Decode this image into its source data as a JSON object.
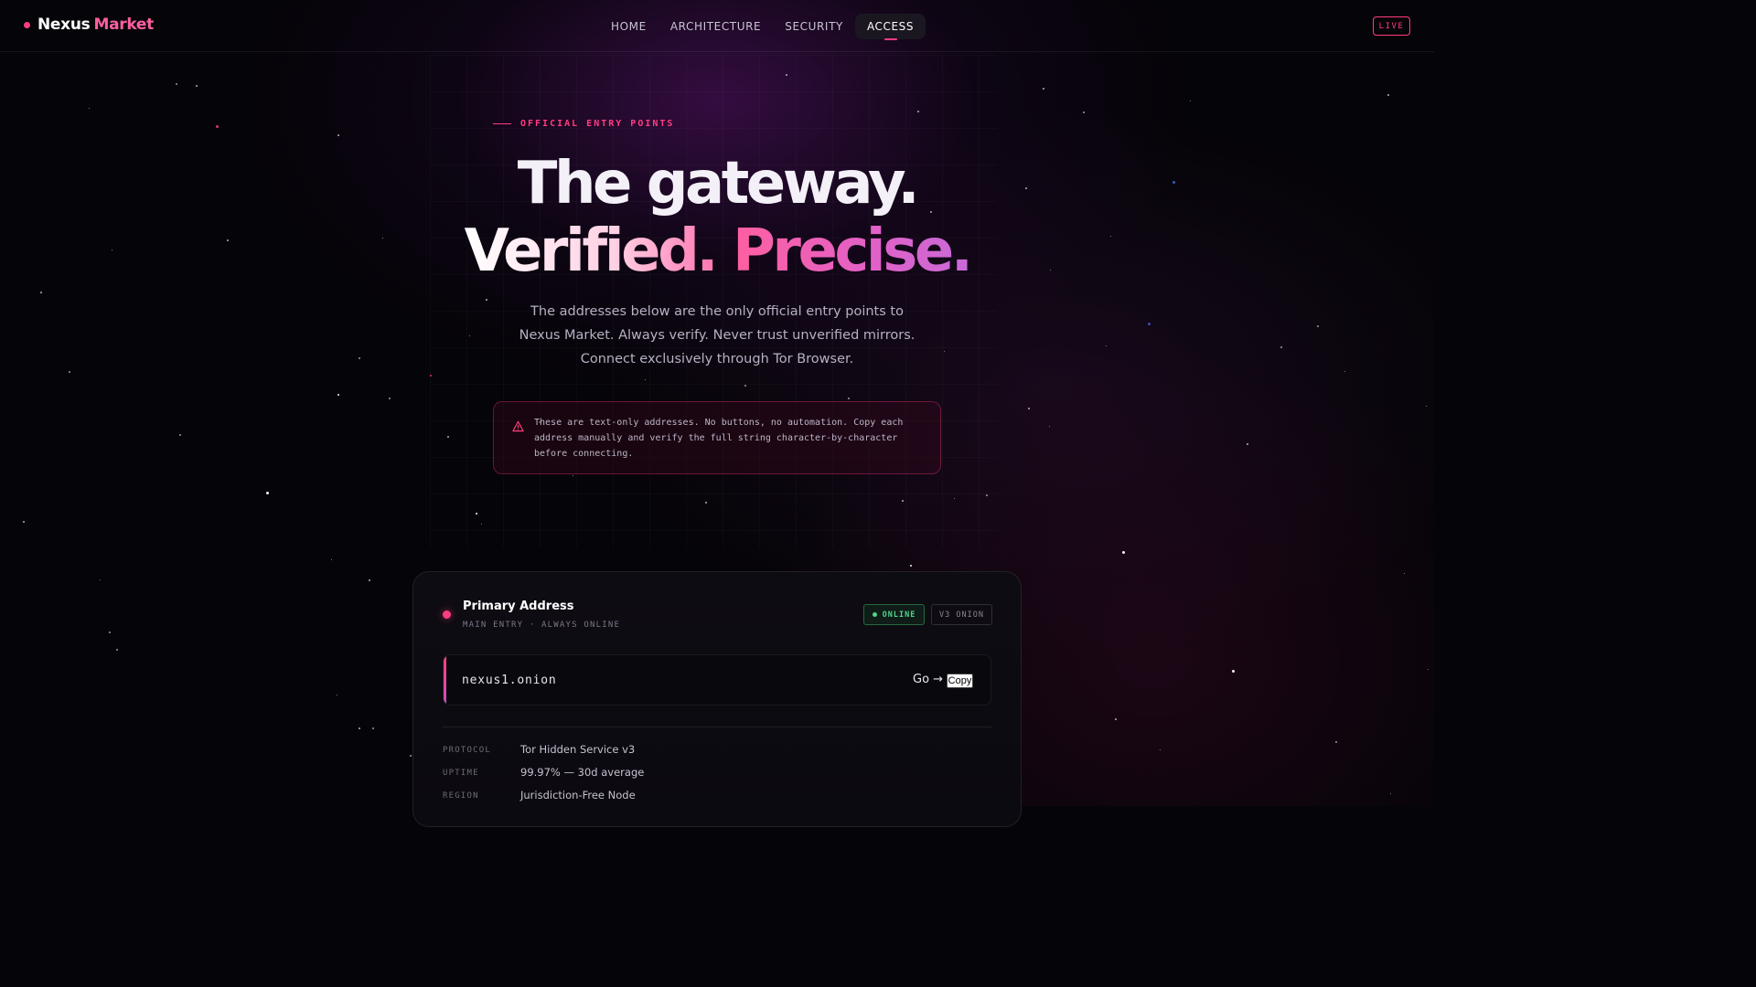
{
  "nav": {
    "brand_part1": "Nexus",
    "brand_part2": "Market",
    "links": [
      {
        "label": "HOME"
      },
      {
        "label": "ARCHITECTURE"
      },
      {
        "label": "SECURITY"
      },
      {
        "label": "ACCESS",
        "active": true
      }
    ],
    "live_label": "LIVE"
  },
  "hero": {
    "eyebrow": "OFFICIAL ENTRY POINTS",
    "title_line1": "The gateway.",
    "title_line2a": "Verified.",
    "title_line2b": "Precise.",
    "subtitle": "The addresses below are the only official entry points to Nexus Market. Always verify. Never trust unverified mirrors. Connect exclusively through Tor Browser."
  },
  "warning": {
    "icon": "warning-triangle-icon",
    "text": "These are text-only addresses. No buttons, no automation. Copy each address manually and verify the full string character-by-character before connecting."
  },
  "card": {
    "title": "Primary Address",
    "subtitle": "MAIN ENTRY · ALWAYS ONLINE",
    "status_badge": "ONLINE",
    "type_badge": "V3 ONION",
    "address": "nexus1.onion",
    "go_label": "Go →",
    "copy_label": "Copy",
    "meta": [
      {
        "key": "PROTOCOL",
        "value": "Tor Hidden Service v3"
      },
      {
        "key": "UPTIME",
        "value": "99.97% — 30d average"
      },
      {
        "key": "REGION",
        "value": "Jurisdiction-Free Node"
      }
    ]
  },
  "colors": {
    "accent": "#ff3d7f",
    "online": "#4fd58a",
    "background": "#050408"
  }
}
